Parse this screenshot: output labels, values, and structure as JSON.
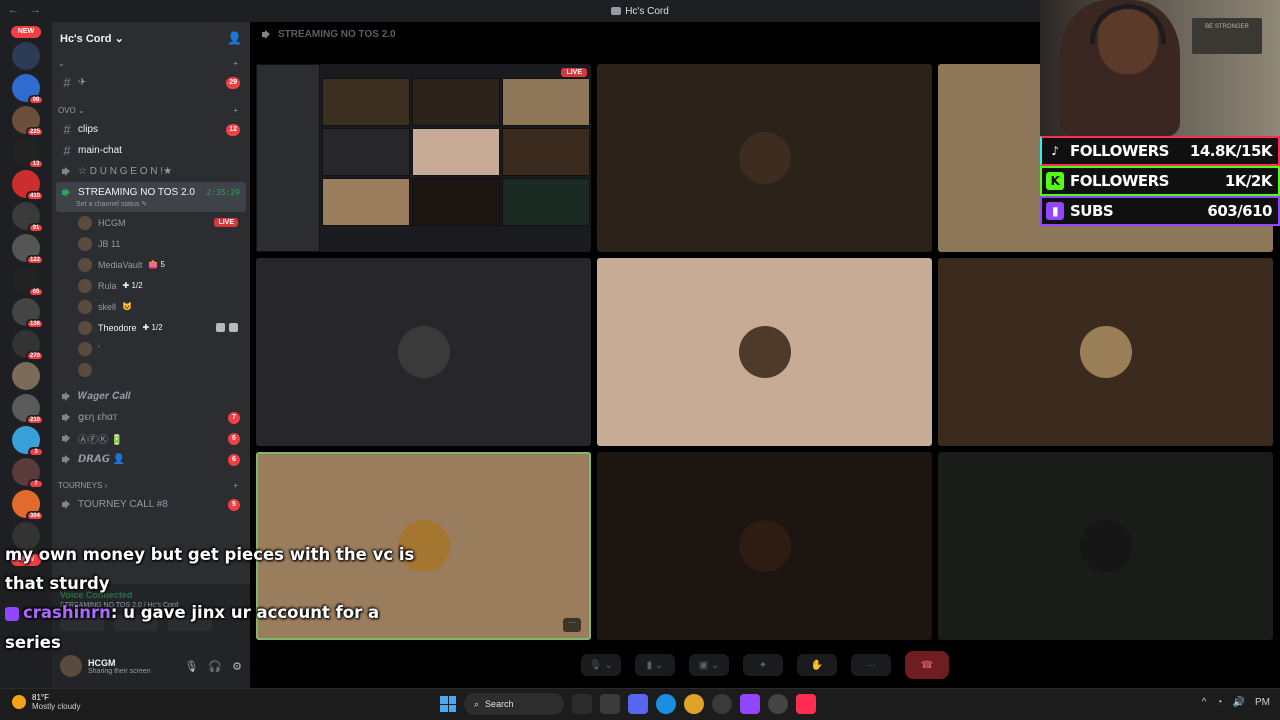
{
  "window": {
    "title": "Hc's Cord",
    "back_fwd": "← →"
  },
  "rail": {
    "new_top": "NEW",
    "new_bottom": "NEW",
    "servers": [
      {
        "badge": "",
        "color": "#2d3a55"
      },
      {
        "badge": "98",
        "color": "#2f6bd1"
      },
      {
        "badge": "225",
        "color": "#6b4f3a"
      },
      {
        "badge": "13",
        "color": "#222"
      },
      {
        "badge": "410",
        "color": "#cc2d2d"
      },
      {
        "badge": "91",
        "color": "#3a3a3a"
      },
      {
        "badge": "122",
        "color": "#555"
      },
      {
        "badge": "65",
        "color": "#222"
      },
      {
        "badge": "136",
        "color": "#444"
      },
      {
        "badge": "270",
        "color": "#333"
      },
      {
        "badge": "",
        "color": "#7a6a5a"
      },
      {
        "badge": "210",
        "color": "#5a5a5a"
      },
      {
        "badge": "3",
        "color": "#3aa0d8"
      },
      {
        "badge": "7",
        "color": "#5a3a3a"
      },
      {
        "badge": "304",
        "color": "#e36a2d"
      },
      {
        "badge": "",
        "color": "#333"
      }
    ]
  },
  "sidebar": {
    "server_name": "Hc's Cord ⌄",
    "cat_1": "⌄",
    "cat_2": "OVO ⌄",
    "cat_3": "TOURNEYS ›",
    "channels_top": [
      {
        "name": "✈",
        "count": "29"
      }
    ],
    "channels_ovo": [
      {
        "name": "clips",
        "count": "12",
        "bright": true
      },
      {
        "name": "main-chat",
        "count": "",
        "bright": true
      },
      {
        "name": "☆ D U N G E O N !★",
        "count": "",
        "voice": true
      }
    ],
    "active_voice": {
      "name": "STREAMING NO TOS 2.0",
      "timer": "2:35:29",
      "status": "Set a channel status ✎"
    },
    "voice_users": [
      {
        "name": "HCGM",
        "tag": "",
        "live": "LIVE",
        "bright": false
      },
      {
        "name": "JB 11",
        "tag": "",
        "live": "",
        "bright": false
      },
      {
        "name": "MediaVault",
        "tag": "👛 5",
        "live": "",
        "bright": false
      },
      {
        "name": "Rula",
        "tag": "✚ 1/2",
        "live": "",
        "bright": false
      },
      {
        "name": "skell",
        "tag": "😺",
        "live": "",
        "bright": false
      },
      {
        "name": "Theodore",
        "tag": "✚ 1/2",
        "live": "",
        "bright": true
      },
      {
        "name": "'",
        "tag": "",
        "live": "",
        "bright": false
      },
      {
        "name": "",
        "tag": "",
        "live": "",
        "bright": false
      }
    ],
    "voice_more": [
      {
        "name": "𝑾𝒂𝒈𝒆𝒓 𝑪𝒂𝒍𝒍",
        "count": ""
      },
      {
        "name": "ցεη εhαт",
        "count": "7"
      },
      {
        "name": "ⒶⒻⓀ 🔋",
        "count": "6"
      },
      {
        "name": "𝘿𝙍𝘼𝙂 👤",
        "count": "6"
      }
    ],
    "tourney": {
      "name": "TOURNEY CALL #8",
      "count": "5"
    }
  },
  "voice_panel": {
    "connected": "Voice Connected",
    "sub": "STREAMING NO TOS 2.0 / Hc's Cord"
  },
  "user_panel": {
    "name": "HCGM",
    "status": "Sharing their screen"
  },
  "stage": {
    "header": "STREAMING NO TOS 2.0",
    "live_label": "LIVE",
    "more": "···",
    "tiles": [
      {
        "bg": "#1a1b1e",
        "avatar": "",
        "kind": "screen"
      },
      {
        "bg": "#2b2219",
        "avatar": "#3d2d20"
      },
      {
        "bg": "#8e7659",
        "avatar": ""
      },
      {
        "bg": "#27272b",
        "avatar": "#3a3a3a"
      },
      {
        "bg": "#c7ab94",
        "avatar": "#4d3a2a"
      },
      {
        "bg": "#3b2a1e",
        "avatar": "#9a7e5a"
      },
      {
        "bg": "#9a7d5c",
        "avatar": "#a4762f",
        "selected": true
      },
      {
        "bg": "#1d1510",
        "avatar": "#2e1c12"
      },
      {
        "bg": "#1a1c1a",
        "avatar": "#161616"
      }
    ]
  },
  "overlay": {
    "sign": "BE STRONGER",
    "stats": [
      {
        "label": "FOLLOWERS",
        "value": "14.8K/15K",
        "icon": "tiktok-icon",
        "glyph": "♪"
      },
      {
        "label": "FOLLOWERS",
        "value": "1K/2K",
        "icon": "kick-icon",
        "glyph": "K"
      },
      {
        "label": "SUBS",
        "value": "603/610",
        "icon": "twitch-icon",
        "glyph": "▮"
      }
    ]
  },
  "captions": {
    "line1": "my own money but get pieces with the vc is",
    "line2": "that sturdy",
    "chat_user": "crashinrn",
    "chat_msg": ": u gave jinx ur account for a",
    "line4": "series"
  },
  "taskbar": {
    "temp": "81°F",
    "weather": "Mostly cloudy",
    "search": "Search",
    "time": "PM"
  }
}
